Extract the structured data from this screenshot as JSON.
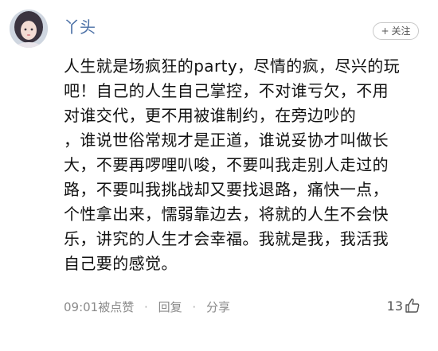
{
  "post": {
    "username": "丫头",
    "follow_label": "关注",
    "follow_icon": "plus-icon",
    "content_lines": [
      "人生就是场疯狂的party，尽情的疯，尽兴的玩",
      "吧！自己的人生自己掌控，不对谁亏欠，不用",
      "对谁交代，更不用被谁制约，在旁边吵的",
      "，谁说世俗常规才是正道，谁说妥协才叫做长",
      "大，不要再啰哩叭唆，不要叫我走别人走过的",
      "路，不要叫我挑战却又要找退路，痛快一点，",
      "个性拿出来，懦弱靠边去，将就的人生不会快",
      "乐，讲究的人生才会幸福。我就是我，我活我",
      "自己要的感觉。"
    ],
    "time": "09:01",
    "liked_by_label": "被点赞",
    "reply_label": "回复",
    "share_label": "分享",
    "separator": "·",
    "like_count": "13",
    "like_icon": "thumbs-up-icon"
  },
  "colors": {
    "username": "#4a6fa5",
    "meta_text": "#8a8a8a",
    "body_text": "#111111"
  }
}
